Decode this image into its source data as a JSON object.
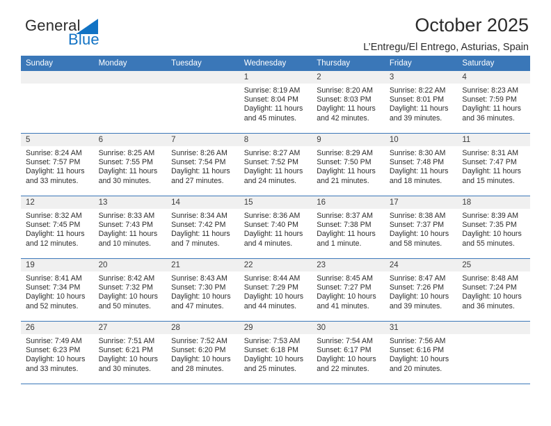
{
  "brand": {
    "name_part1": "General",
    "name_part2": "Blue",
    "triangle_color": "#1273c4"
  },
  "header": {
    "title": "October 2025",
    "subtitle": "L’Entregu/El Entrego, Asturias, Spain"
  },
  "theme": {
    "header_bar": "#3a77b8",
    "daynum_strip": "#f0f0f0",
    "text": "#2b2b2b"
  },
  "weekdays": [
    "Sunday",
    "Monday",
    "Tuesday",
    "Wednesday",
    "Thursday",
    "Friday",
    "Saturday"
  ],
  "weeks": [
    [
      {
        "day": "",
        "empty": true
      },
      {
        "day": "",
        "empty": true
      },
      {
        "day": "",
        "empty": true
      },
      {
        "day": "1",
        "sunrise": "Sunrise: 8:19 AM",
        "sunset": "Sunset: 8:04 PM",
        "daylight": "Daylight: 11 hours and 45 minutes."
      },
      {
        "day": "2",
        "sunrise": "Sunrise: 8:20 AM",
        "sunset": "Sunset: 8:03 PM",
        "daylight": "Daylight: 11 hours and 42 minutes."
      },
      {
        "day": "3",
        "sunrise": "Sunrise: 8:22 AM",
        "sunset": "Sunset: 8:01 PM",
        "daylight": "Daylight: 11 hours and 39 minutes."
      },
      {
        "day": "4",
        "sunrise": "Sunrise: 8:23 AM",
        "sunset": "Sunset: 7:59 PM",
        "daylight": "Daylight: 11 hours and 36 minutes."
      }
    ],
    [
      {
        "day": "5",
        "sunrise": "Sunrise: 8:24 AM",
        "sunset": "Sunset: 7:57 PM",
        "daylight": "Daylight: 11 hours and 33 minutes."
      },
      {
        "day": "6",
        "sunrise": "Sunrise: 8:25 AM",
        "sunset": "Sunset: 7:55 PM",
        "daylight": "Daylight: 11 hours and 30 minutes."
      },
      {
        "day": "7",
        "sunrise": "Sunrise: 8:26 AM",
        "sunset": "Sunset: 7:54 PM",
        "daylight": "Daylight: 11 hours and 27 minutes."
      },
      {
        "day": "8",
        "sunrise": "Sunrise: 8:27 AM",
        "sunset": "Sunset: 7:52 PM",
        "daylight": "Daylight: 11 hours and 24 minutes."
      },
      {
        "day": "9",
        "sunrise": "Sunrise: 8:29 AM",
        "sunset": "Sunset: 7:50 PM",
        "daylight": "Daylight: 11 hours and 21 minutes."
      },
      {
        "day": "10",
        "sunrise": "Sunrise: 8:30 AM",
        "sunset": "Sunset: 7:48 PM",
        "daylight": "Daylight: 11 hours and 18 minutes."
      },
      {
        "day": "11",
        "sunrise": "Sunrise: 8:31 AM",
        "sunset": "Sunset: 7:47 PM",
        "daylight": "Daylight: 11 hours and 15 minutes."
      }
    ],
    [
      {
        "day": "12",
        "sunrise": "Sunrise: 8:32 AM",
        "sunset": "Sunset: 7:45 PM",
        "daylight": "Daylight: 11 hours and 12 minutes."
      },
      {
        "day": "13",
        "sunrise": "Sunrise: 8:33 AM",
        "sunset": "Sunset: 7:43 PM",
        "daylight": "Daylight: 11 hours and 10 minutes."
      },
      {
        "day": "14",
        "sunrise": "Sunrise: 8:34 AM",
        "sunset": "Sunset: 7:42 PM",
        "daylight": "Daylight: 11 hours and 7 minutes."
      },
      {
        "day": "15",
        "sunrise": "Sunrise: 8:36 AM",
        "sunset": "Sunset: 7:40 PM",
        "daylight": "Daylight: 11 hours and 4 minutes."
      },
      {
        "day": "16",
        "sunrise": "Sunrise: 8:37 AM",
        "sunset": "Sunset: 7:38 PM",
        "daylight": "Daylight: 11 hours and 1 minute."
      },
      {
        "day": "17",
        "sunrise": "Sunrise: 8:38 AM",
        "sunset": "Sunset: 7:37 PM",
        "daylight": "Daylight: 10 hours and 58 minutes."
      },
      {
        "day": "18",
        "sunrise": "Sunrise: 8:39 AM",
        "sunset": "Sunset: 7:35 PM",
        "daylight": "Daylight: 10 hours and 55 minutes."
      }
    ],
    [
      {
        "day": "19",
        "sunrise": "Sunrise: 8:41 AM",
        "sunset": "Sunset: 7:34 PM",
        "daylight": "Daylight: 10 hours and 52 minutes."
      },
      {
        "day": "20",
        "sunrise": "Sunrise: 8:42 AM",
        "sunset": "Sunset: 7:32 PM",
        "daylight": "Daylight: 10 hours and 50 minutes."
      },
      {
        "day": "21",
        "sunrise": "Sunrise: 8:43 AM",
        "sunset": "Sunset: 7:30 PM",
        "daylight": "Daylight: 10 hours and 47 minutes."
      },
      {
        "day": "22",
        "sunrise": "Sunrise: 8:44 AM",
        "sunset": "Sunset: 7:29 PM",
        "daylight": "Daylight: 10 hours and 44 minutes."
      },
      {
        "day": "23",
        "sunrise": "Sunrise: 8:45 AM",
        "sunset": "Sunset: 7:27 PM",
        "daylight": "Daylight: 10 hours and 41 minutes."
      },
      {
        "day": "24",
        "sunrise": "Sunrise: 8:47 AM",
        "sunset": "Sunset: 7:26 PM",
        "daylight": "Daylight: 10 hours and 39 minutes."
      },
      {
        "day": "25",
        "sunrise": "Sunrise: 8:48 AM",
        "sunset": "Sunset: 7:24 PM",
        "daylight": "Daylight: 10 hours and 36 minutes."
      }
    ],
    [
      {
        "day": "26",
        "sunrise": "Sunrise: 7:49 AM",
        "sunset": "Sunset: 6:23 PM",
        "daylight": "Daylight: 10 hours and 33 minutes."
      },
      {
        "day": "27",
        "sunrise": "Sunrise: 7:51 AM",
        "sunset": "Sunset: 6:21 PM",
        "daylight": "Daylight: 10 hours and 30 minutes."
      },
      {
        "day": "28",
        "sunrise": "Sunrise: 7:52 AM",
        "sunset": "Sunset: 6:20 PM",
        "daylight": "Daylight: 10 hours and 28 minutes."
      },
      {
        "day": "29",
        "sunrise": "Sunrise: 7:53 AM",
        "sunset": "Sunset: 6:18 PM",
        "daylight": "Daylight: 10 hours and 25 minutes."
      },
      {
        "day": "30",
        "sunrise": "Sunrise: 7:54 AM",
        "sunset": "Sunset: 6:17 PM",
        "daylight": "Daylight: 10 hours and 22 minutes."
      },
      {
        "day": "31",
        "sunrise": "Sunrise: 7:56 AM",
        "sunset": "Sunset: 6:16 PM",
        "daylight": "Daylight: 10 hours and 20 minutes."
      },
      {
        "day": "",
        "empty": true
      }
    ]
  ]
}
